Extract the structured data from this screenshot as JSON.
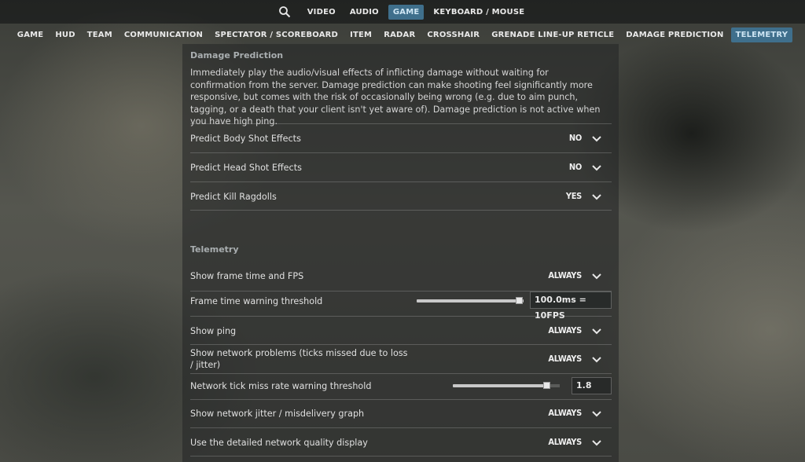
{
  "top_nav": {
    "search_icon": "search-icon",
    "tabs": [
      "VIDEO",
      "AUDIO",
      "GAME",
      "KEYBOARD / MOUSE"
    ],
    "active": "GAME"
  },
  "sub_nav": {
    "tabs": [
      "GAME",
      "HUD",
      "TEAM",
      "COMMUNICATION",
      "SPECTATOR / SCOREBOARD",
      "ITEM",
      "RADAR",
      "CROSSHAIR",
      "GRENADE LINE-UP RETICLE",
      "DAMAGE PREDICTION",
      "TELEMETRY"
    ],
    "active": "TELEMETRY"
  },
  "damage_prediction": {
    "title": "Damage Prediction",
    "description": "Immediately play the audio/visual effects of inflicting damage without waiting for confirmation from the server. Damage prediction can make shooting feel significantly more responsive, but comes with the risk of occasionally being wrong (e.g. due to aim punch, tagging, or a death that your client isn't yet aware of). Damage prediction is not active when you have high ping.",
    "settings": [
      {
        "label": "Predict Body Shot Effects",
        "value": "NO"
      },
      {
        "label": "Predict Head Shot Effects",
        "value": "NO"
      },
      {
        "label": "Predict Kill Ragdolls",
        "value": "YES"
      }
    ]
  },
  "telemetry": {
    "title": "Telemetry",
    "show_frame_time": {
      "label": "Show frame time and FPS",
      "value": "ALWAYS"
    },
    "frame_time_threshold": {
      "label": "Frame time warning threshold",
      "value": "100.0ms = 10FPS",
      "slider_fraction": 1.0
    },
    "show_ping": {
      "label": "Show ping",
      "value": "ALWAYS"
    },
    "show_network_problems": {
      "label": "Show network problems (ticks missed due to loss / jitter)",
      "value": "ALWAYS"
    },
    "tick_miss_threshold": {
      "label": "Network tick miss rate warning threshold",
      "value": "1.8",
      "slider_fraction": 0.87
    },
    "show_jitter_graph": {
      "label": "Show network jitter / misdelivery graph",
      "value": "ALWAYS"
    },
    "detailed_network_display": {
      "label": "Use the detailed network quality display",
      "value": "ALWAYS"
    }
  },
  "colors": {
    "accent_tab": "#3f6f8c",
    "text": "#e0e0e0",
    "section_title": "#a9aeb0"
  }
}
